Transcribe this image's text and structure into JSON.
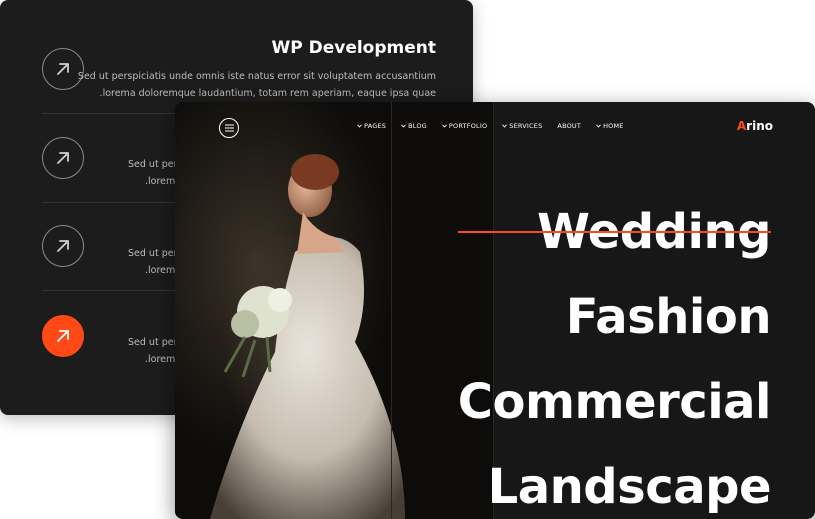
{
  "services": {
    "items": [
      {
        "title": "WP Development",
        "desc_line1": "Sed ut perspiciatis unde omnis iste natus error sit voluptatem accusantium",
        "desc_line2": ".lorema doloremque laudantium, totam rem aperiam, eaque ipsa quae",
        "icon": "arrow-up-right-icon",
        "active": false
      },
      {
        "title": "",
        "desc_line1": "Sed ut persp",
        "desc_line2": ".lorema",
        "icon": "arrow-up-right-icon",
        "active": false
      },
      {
        "title": "",
        "desc_line1": "Sed ut persp",
        "desc_line2": ".lorema",
        "icon": "arrow-up-right-icon",
        "active": false
      },
      {
        "title": "",
        "desc_line1": "Sed ut persp",
        "desc_line2": ".lorema",
        "icon": "arrow-up-right-icon",
        "active": true
      }
    ]
  },
  "header": {
    "menu_icon": "hamburger-icon",
    "nav": [
      {
        "label": "PAGES",
        "has_dropdown": true
      },
      {
        "label": "BLOG",
        "has_dropdown": true
      },
      {
        "label": "PORTFOLIO",
        "has_dropdown": true
      },
      {
        "label": "SERVICES",
        "has_dropdown": true
      },
      {
        "label": "ABOUT",
        "has_dropdown": false
      },
      {
        "label": "HOME",
        "has_dropdown": true
      }
    ],
    "logo_first": "A",
    "logo_rest": "rino"
  },
  "hero": {
    "words": [
      "Wedding",
      "Fashion",
      "Commercial",
      "Landscape"
    ],
    "struck_index": 0
  },
  "colors": {
    "accent": "#ff4a17",
    "card_bg": "#1c1c1c",
    "hero_bg": "#171717",
    "text": "#ffffff"
  }
}
